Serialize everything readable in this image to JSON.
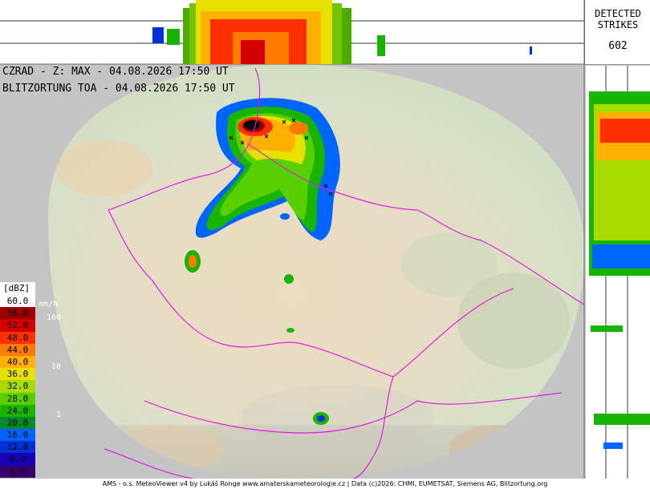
{
  "header": {
    "radar_line": "CZRAD - Z: MAX - 04.08.2026 17:50 UT",
    "lightning_line": "BLITZORTUNG TOA - 04.08.2026 17:50 UT"
  },
  "strikes": {
    "label_line1": "DETECTED",
    "label_line2": "STRIKES",
    "count": "602"
  },
  "legend": {
    "unit": "[dBZ]",
    "rate_unit": "mm/h",
    "levels": [
      {
        "value": "60.0",
        "color": "#ffffff",
        "text_color": "#000000"
      },
      {
        "value": "56.0",
        "color": "#9c0000",
        "text_color": "#000000"
      },
      {
        "value": "52.0",
        "color": "#d40000",
        "text_color": "#000000"
      },
      {
        "value": "48.0",
        "color": "#ff3000",
        "text_color": "#000000"
      },
      {
        "value": "44.0",
        "color": "#ff7c00",
        "text_color": "#000000"
      },
      {
        "value": "40.0",
        "color": "#ffb000",
        "text_color": "#000000"
      },
      {
        "value": "36.0",
        "color": "#e8e000",
        "text_color": "#000000"
      },
      {
        "value": "32.0",
        "color": "#a8dc00",
        "text_color": "#000000"
      },
      {
        "value": "28.0",
        "color": "#58d000",
        "text_color": "#000000"
      },
      {
        "value": "24.0",
        "color": "#18b400",
        "text_color": "#000000"
      },
      {
        "value": "20.0",
        "color": "#008c2c",
        "text_color": "#000000"
      },
      {
        "value": "16.0",
        "color": "#0064ff",
        "text_color": "#000000"
      },
      {
        "value": "12.0",
        "color": "#0030d8",
        "text_color": "#000000"
      },
      {
        "value": "8.0",
        "color": "#1800b4",
        "text_color": "#000000"
      },
      {
        "value": "4.0",
        "color": "#38006c",
        "text_color": "#000000"
      }
    ],
    "rates": [
      "100",
      "10",
      "1"
    ]
  },
  "footer": "AMS - o.s. MeteoViewer v4 by Lukáš Ronge www.amaterskameteorologie.cz | Data (c)2026: CHMI, EUMETSAT, Siemens AG, Blitzortung.org"
}
